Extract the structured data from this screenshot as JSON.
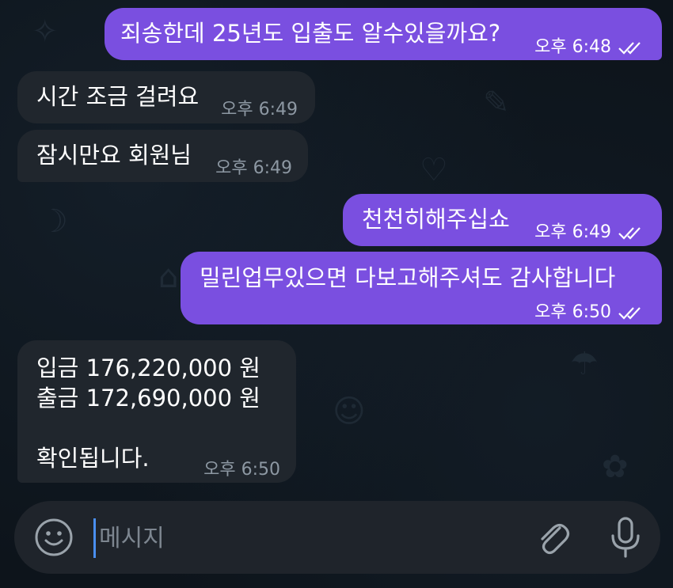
{
  "messages": [
    {
      "direction": "out",
      "text": "죄송한데 25년도 입출도 알수있을까요?",
      "time": "오후 6:48",
      "status": "read"
    },
    {
      "direction": "in",
      "text": "시간 조금 걸려요",
      "time": "오후 6:49"
    },
    {
      "direction": "in",
      "text": "잠시만요 회원님",
      "time": "오후 6:49"
    },
    {
      "direction": "out",
      "text": "천천히해주십쇼",
      "time": "오후 6:49",
      "status": "read"
    },
    {
      "direction": "out",
      "text": "밀린업무있으면 다보고해주셔도 감사합니다",
      "time": "오후 6:50",
      "status": "read"
    },
    {
      "direction": "in",
      "lines": [
        "입금 176,220,000 원",
        "출금 172,690,000 원",
        "",
        "확인됩니다."
      ],
      "time": "오후 6:50"
    }
  ],
  "input": {
    "placeholder": "메시지"
  },
  "icons": {
    "emoji": "smile-icon",
    "attach": "paperclip-icon",
    "mic": "microphone-icon"
  },
  "colors": {
    "outgoing_bubble": "#7a4fe0",
    "incoming_bubble": "#20262d",
    "background": "#0d141b"
  }
}
